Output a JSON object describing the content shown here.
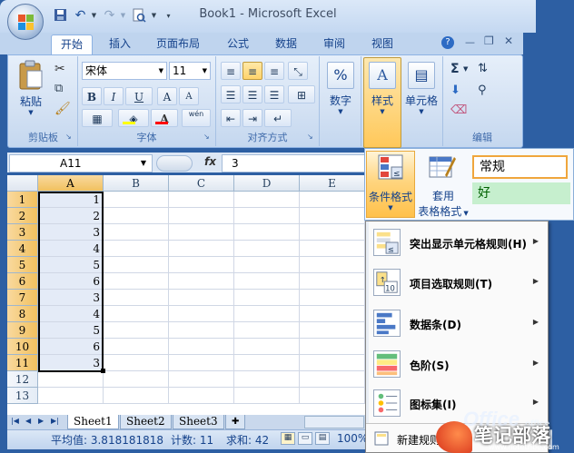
{
  "window": {
    "title": "Book1 - Microsoft Excel"
  },
  "quick_access": {
    "save_icon": "save-icon",
    "undo_icon": "undo-icon",
    "redo_icon": "redo-icon",
    "preview_icon": "print-preview-icon",
    "customize_icon": "chevron-down-icon"
  },
  "tabs": [
    {
      "label": "开始"
    },
    {
      "label": "插入"
    },
    {
      "label": "页面布局"
    },
    {
      "label": "公式"
    },
    {
      "label": "数据"
    },
    {
      "label": "审阅"
    },
    {
      "label": "视图"
    }
  ],
  "ribbon": {
    "clipboard": {
      "paste": "粘贴",
      "group": "剪贴板"
    },
    "font": {
      "name": "宋体",
      "size": "11",
      "group": "字体",
      "bold": "B",
      "italic": "I",
      "underline": "U",
      "grow": "A",
      "shrink": "A",
      "fill_color_hex": "#ffff00",
      "font_color_hex": "#ff0000",
      "wen": "wén"
    },
    "alignment": {
      "group": "对齐方式"
    },
    "number": {
      "label": "数字",
      "symbol": "%"
    },
    "styles": {
      "label": "样式"
    },
    "cells": {
      "label": "单元格"
    },
    "editing": {
      "group": "编辑",
      "sigma": "Σ"
    }
  },
  "formula_bar": {
    "name_box": "A11",
    "fx": "fx",
    "value": "3"
  },
  "sheet": {
    "columns": [
      "A",
      "B",
      "C",
      "D",
      "E"
    ],
    "rows": [
      "1",
      "2",
      "3",
      "4",
      "5",
      "6",
      "7",
      "8",
      "9",
      "10",
      "11",
      "12",
      "13"
    ],
    "col_a_values": [
      "1",
      "2",
      "3",
      "4",
      "5",
      "6",
      "3",
      "4",
      "5",
      "6",
      "3",
      "",
      ""
    ],
    "selected_column": "A"
  },
  "sheet_tabs": [
    {
      "label": "Sheet1"
    },
    {
      "label": "Sheet2"
    },
    {
      "label": "Sheet3"
    }
  ],
  "status_bar": {
    "average": "平均值: 3.818181818",
    "count": "计数: 11",
    "sum": "求和: 42",
    "zoom": "100%"
  },
  "styles_gallery": {
    "conditional_format": "条件格式",
    "table_format_line1": "套用",
    "table_format_line2": "表格格式",
    "normal": "常规",
    "good": "好"
  },
  "cf_menu": {
    "items": [
      {
        "label": "突出显示单元格规则(H)",
        "icon": "highlight-rules-icon"
      },
      {
        "label": "项目选取规则(T)",
        "icon": "top-bottom-rules-icon"
      },
      {
        "label": "数据条(D)",
        "icon": "data-bars-icon"
      },
      {
        "label": "色阶(S)",
        "icon": "color-scales-icon"
      },
      {
        "label": "图标集(I)",
        "icon": "icon-sets-icon"
      }
    ],
    "new_rule": "新建规则"
  },
  "watermark": {
    "text": "笔记部落",
    "url": "www.notetribe.com",
    "brand": "Office",
    "site": "office"
  }
}
